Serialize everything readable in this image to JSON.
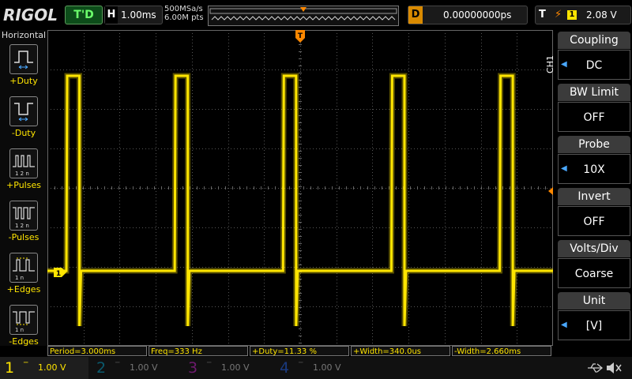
{
  "top": {
    "logo": "RIGOL",
    "run_status": "T'D",
    "timebase_label": "H",
    "timebase_value": "1.00ms",
    "sample_rate": "500MSa/s",
    "mem_depth": "6.00M pts",
    "delay_label": "D",
    "delay_value": "0.00000000ps",
    "trigger_label": "T",
    "trigger_channel": "1",
    "trigger_level": "2.08 V",
    "trigger_marker": "T"
  },
  "left_menu": {
    "title": "Horizontal",
    "items": [
      {
        "label": "+Duty",
        "icon": "positive-duty-icon"
      },
      {
        "label": "-Duty",
        "icon": "negative-duty-icon"
      },
      {
        "label": "+Pulses",
        "icon": "positive-pulses-icon"
      },
      {
        "label": "-Pulses",
        "icon": "negative-pulses-icon"
      },
      {
        "label": "+Edges",
        "icon": "rising-edges-icon"
      },
      {
        "label": "-Edges",
        "icon": "falling-edges-icon"
      }
    ]
  },
  "right_menu": {
    "channel": "CH1",
    "items": [
      {
        "title": "Coupling",
        "value": "DC",
        "arrow": true
      },
      {
        "title": "BW Limit",
        "value": "OFF",
        "arrow": false
      },
      {
        "title": "Probe",
        "value": "10X",
        "arrow": true
      },
      {
        "title": "Invert",
        "value": "OFF",
        "arrow": false
      },
      {
        "title": "Volts/Div",
        "value": "Coarse",
        "arrow": false
      },
      {
        "title": "Unit",
        "value": "[V]",
        "arrow": true
      }
    ]
  },
  "waveform": {
    "channel_marker": "1",
    "trigger_marker": "T",
    "color": "#ffe500",
    "period_ms": 3.0,
    "high_width_us": 340.0
  },
  "measurements": [
    "Period=3.000ms",
    "Freq=333 Hz",
    "+Duty=11.33 %",
    "+Width=340.0us",
    "-Width=2.660ms"
  ],
  "channels": [
    {
      "num": "1",
      "scale": "1.00 V",
      "color": "#ffe500",
      "active": true
    },
    {
      "num": "2",
      "scale": "1.00 V",
      "color": "#00c8ff",
      "active": false
    },
    {
      "num": "3",
      "scale": "1.00 V",
      "color": "#ff40ff",
      "active": false
    },
    {
      "num": "4",
      "scale": "1.00 V",
      "color": "#3a7bff",
      "active": false
    }
  ],
  "colors": {
    "trigger": "#ff8800",
    "channel1": "#ffe500",
    "accent_blue": "#4aa8ff"
  }
}
